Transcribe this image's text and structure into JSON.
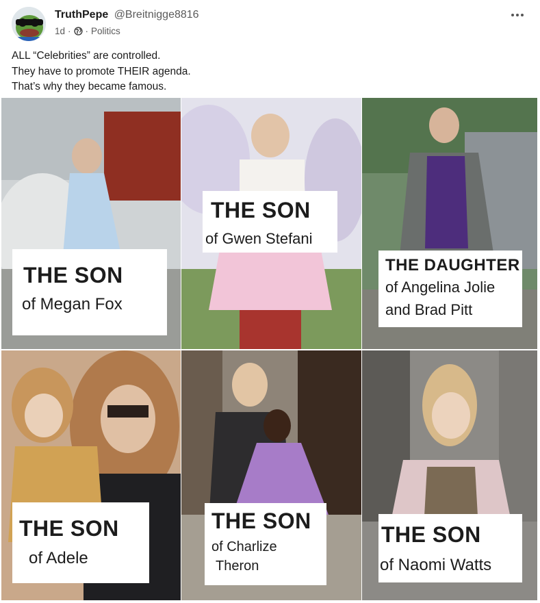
{
  "post": {
    "display_name": "TruthPepe",
    "handle": "@Breitnigge8816",
    "time": "1d",
    "separator": "·",
    "category": "Politics",
    "text_lines": [
      "ALL “Celebrities” are controlled.",
      "They have to promote THEIR agenda.",
      "That’s why they became famous."
    ],
    "icons": {
      "more": "more-horizontal-icon",
      "globe": "globe-icon",
      "avatar": "pepe-frog-sunglasses-avatar"
    }
  },
  "image": {
    "panels": [
      {
        "title": "THE SON",
        "sub1": "of Megan Fox",
        "sub2": ""
      },
      {
        "title": "THE SON",
        "sub1": "of Gwen Stefani",
        "sub2": ""
      },
      {
        "title": "THE DAUGHTER",
        "sub1": "of Angelina Jolie",
        "sub2": "and Brad Pitt"
      },
      {
        "title": "THE SON",
        "sub1": "of Adele",
        "sub2": ""
      },
      {
        "title": "THE SON",
        "sub1": "of Charlize",
        "sub2": "Theron"
      },
      {
        "title": "THE SON",
        "sub1": "of Naomi Watts",
        "sub2": ""
      }
    ]
  },
  "colors": {
    "text": "#1a1a1a",
    "muted": "#5a5a5a",
    "background": "#ffffff"
  }
}
